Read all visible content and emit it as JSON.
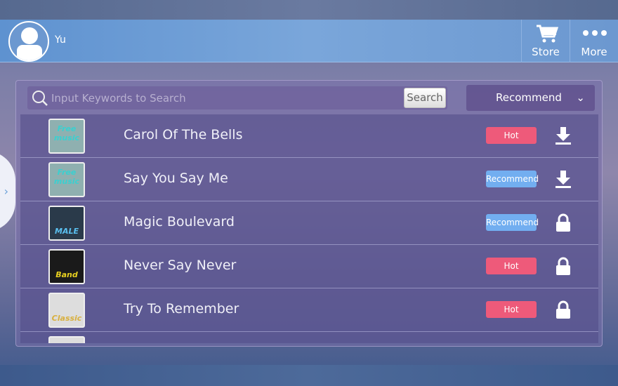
{
  "header": {
    "username": "Yu",
    "store_label": "Store",
    "more_label": "More"
  },
  "search": {
    "placeholder": "Input Keywords to Search",
    "button": "Search"
  },
  "sort": {
    "selected": "Recommend"
  },
  "colors": {
    "hot": "#ee5a7a",
    "recommend": "#72aef0"
  },
  "songs": [
    {
      "title": "Carol Of The Bells",
      "badge": "Hot",
      "action": "download-icon",
      "cover": "Free music"
    },
    {
      "title": "Say You Say Me",
      "badge": "Recommend",
      "action": "download-icon",
      "cover": "Free music"
    },
    {
      "title": "Magic Boulevard",
      "badge": "Recommend",
      "action": "lock-icon",
      "cover": "MALE"
    },
    {
      "title": "Never Say Never",
      "badge": "Hot",
      "action": "lock-icon",
      "cover": "Band"
    },
    {
      "title": "Try To Remember",
      "badge": "Hot",
      "action": "lock-icon",
      "cover": "Classic"
    }
  ]
}
